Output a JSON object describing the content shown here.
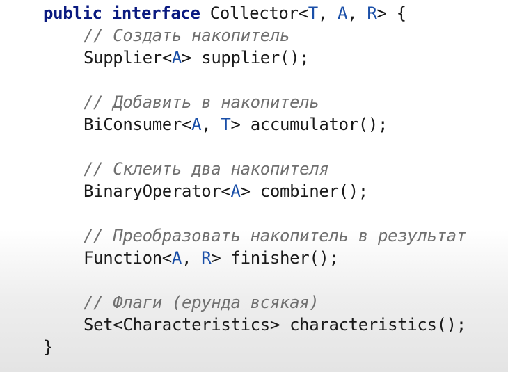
{
  "code": {
    "header": {
      "kw_public": "public",
      "kw_interface": "interface",
      "name": "Collector<",
      "t": "T",
      "sep1": ", ",
      "a": "A",
      "sep2": ", ",
      "r": "R",
      "tail": "> {"
    },
    "methods": [
      {
        "comment": "// Создать накопитель",
        "type_prefix": "Supplier<",
        "params": [
          "A"
        ],
        "seps": [],
        "suffix": "> supplier();"
      },
      {
        "comment": "// Добавить в накопитель",
        "type_prefix": "BiConsumer<",
        "params": [
          "A",
          "T"
        ],
        "seps": [
          ", "
        ],
        "suffix": "> accumulator();"
      },
      {
        "comment": "// Склеить два накопителя",
        "type_prefix": "BinaryOperator<",
        "params": [
          "A"
        ],
        "seps": [],
        "suffix": "> combiner();"
      },
      {
        "comment": "// Преобразовать накопитель в результат",
        "type_prefix": "Function<",
        "params": [
          "A",
          "R"
        ],
        "seps": [
          ", "
        ],
        "suffix": "> finisher();"
      },
      {
        "comment": "// Флаги (ерунда всякая)",
        "signature": "Set<Characteristics> characteristics();"
      }
    ],
    "closing": "}"
  }
}
